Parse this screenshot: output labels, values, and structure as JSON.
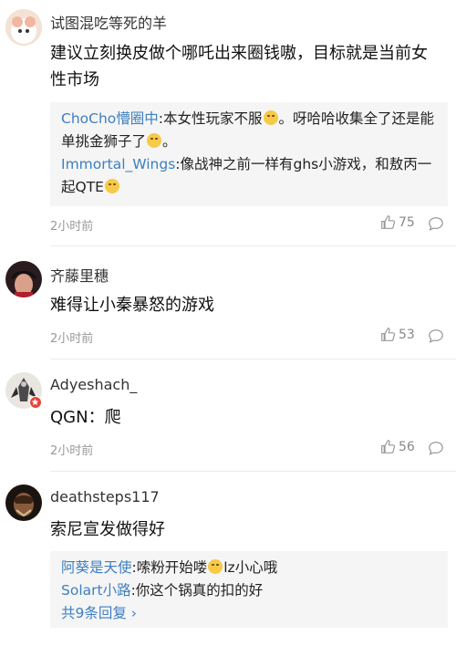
{
  "comments": [
    {
      "username": "试图混吃等死的羊",
      "text": "建议立刻换皮做个哪吒出来圈钱嗷，目标就是当前女性市场",
      "replies": [
        {
          "name": "ChoCho懵圈中",
          "text_a": ":本女性玩家不服",
          "text_b": "。呀哈哈收集全了还是能单挑金狮子了",
          "text_c": "。"
        },
        {
          "name": "Immortal_Wings",
          "text_a": ":像战神之前一样有ghs小游戏，和敖丙一起QTE",
          "text_b": "",
          "text_c": ""
        }
      ],
      "time": "2小时前",
      "likes": "75"
    },
    {
      "username": "齐藤里穗",
      "text": "难得让小秦暴怒的游戏",
      "time": "2小时前",
      "likes": "53"
    },
    {
      "username": "Adyeshach_",
      "text": "QGN：爬",
      "time": "2小时前",
      "likes": "56"
    },
    {
      "username": "deathsteps117",
      "text": "索尼宣发做得好",
      "replies": [
        {
          "name": "阿葵是天使",
          "text_a": ":嗦粉开始喽",
          "text_b": "lz小心哦"
        },
        {
          "name": "Solart小路",
          "text_a": ":你这个锅真的扣的好",
          "text_b": ""
        }
      ],
      "more": "共9条回复 ›"
    }
  ],
  "colors": {
    "link": "#3d7fc1",
    "meta": "#999999",
    "reply_bg": "#f5f5f5"
  }
}
